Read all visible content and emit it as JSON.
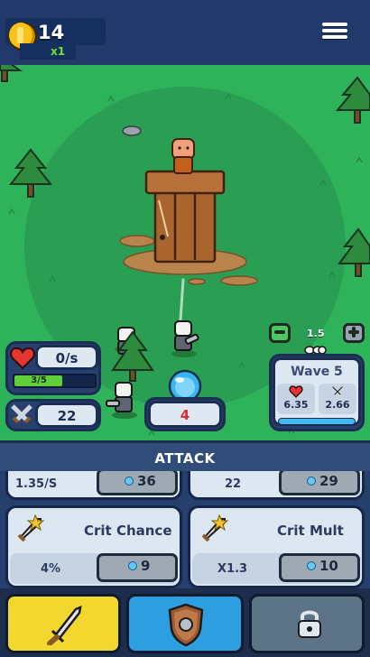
{
  "currency": {
    "coins": "14",
    "multiplier": "x1"
  },
  "hud": {
    "regen_rate": "0/s",
    "health": "3/5",
    "health_fraction": 0.6,
    "attack_power": "22",
    "mana": "4",
    "zoom_level": "1.5"
  },
  "wave": {
    "label": "Wave 5",
    "enemy_health": "6.35",
    "enemy_damage": "2.66",
    "progress": 0.0
  },
  "attack": {
    "title": "ATTACK",
    "row1": [
      {
        "value": "1.35/S",
        "cost": "36"
      },
      {
        "value": "22",
        "cost": "29"
      }
    ],
    "row2": [
      {
        "name": "Crit Chance",
        "value": "4%",
        "cost": "9"
      },
      {
        "name": "Crit Mult",
        "value": "X1.3",
        "cost": "10"
      }
    ]
  },
  "icons": {
    "coin": "coin-icon",
    "menu": "menu-icon",
    "heart": "heart-icon",
    "swords": "crossed-swords-icon",
    "orb": "mana-orb-icon",
    "sword": "sword-icon",
    "shield": "shield-icon",
    "lock": "lock-icon"
  },
  "colors": {
    "grass": "#2fb35a",
    "health_bar": "#5fd03a",
    "nav_attack": "#f1d72e",
    "nav_defense": "#2d9fe0",
    "nav_locked": "#5d7388"
  }
}
